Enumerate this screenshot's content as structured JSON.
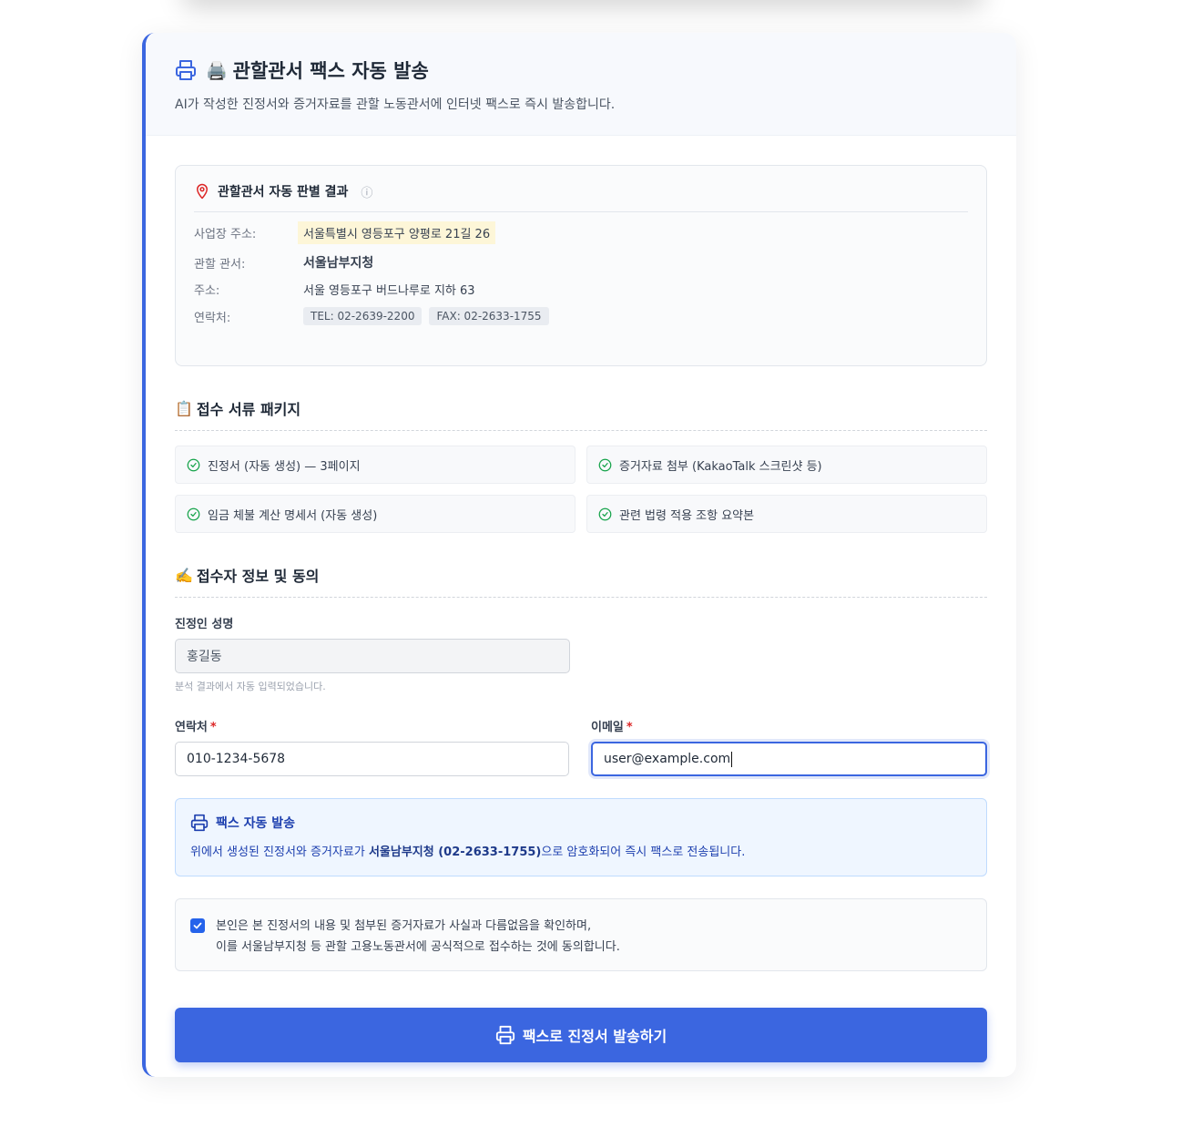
{
  "header": {
    "emoji": "🖨️",
    "title": "관할관서 팩스 자동 발송",
    "subtitle": "AI가 작성한 진정서와 증거자료를 관할 노동관서에 인터넷 팩스로 즉시 발송합니다."
  },
  "office": {
    "heading": "관할관서 자동 판별 결과",
    "info_icon": "ⓘ",
    "rows": {
      "workplace_label": "사업장 주소:",
      "workplace_value": "서울특별시 영등포구 양평로 21길 26",
      "office_label": "관할 관서:",
      "office_value": "서울남부지청",
      "address_label": "주소:",
      "address_value": "서울 영등포구 버드나루로 지하 63",
      "contact_label": "연락처:",
      "tel": "TEL: 02-2639-2200",
      "fax": "FAX: 02-2633-1755"
    }
  },
  "docs_section": {
    "emoji": "📋",
    "title": "접수 서류 패키지",
    "items": [
      "진정서 (자동 생성) — 3페이지",
      "증거자료 첨부 (KakaoTalk 스크린샷 등)",
      "임금 체불 계산 명세서 (자동 생성)",
      "관련 법령 적용 조항 요약본"
    ]
  },
  "applicant_section": {
    "emoji": "✍️",
    "title": "접수자 정보 및 동의",
    "name_label": "진정인 성명",
    "name_value": "홍길동",
    "name_hint": "분석 결과에서 자동 입력되었습니다.",
    "phone_label": "연락처",
    "phone_value": "010-1234-5678",
    "email_label": "이메일",
    "email_value": "user@example.com",
    "required_mark": "*"
  },
  "fax_notice": {
    "title": "팩스 자동 발송",
    "desc_pre": "위에서 생성된 진정서와 증거자료가 ",
    "desc_strong": "서울남부지청 (02-2633-1755)",
    "desc_post": "으로 암호화되어 즉시 팩스로 전송됩니다."
  },
  "consent": {
    "checked": true,
    "line1": "본인은 본 진정서의 내용 및 첨부된 증거자료가 사실과 다름없음을 확인하며,",
    "line2": "이를 서울남부지청 등 관할 고용노동관서에 공식적으로 접수하는 것에 동의합니다."
  },
  "submit": {
    "label": "팩스로 진정서 발송하기"
  },
  "colors": {
    "accent": "#3b66e0",
    "notice_bg": "#eff6ff",
    "required": "#dc2626",
    "check": "#16a34a"
  }
}
